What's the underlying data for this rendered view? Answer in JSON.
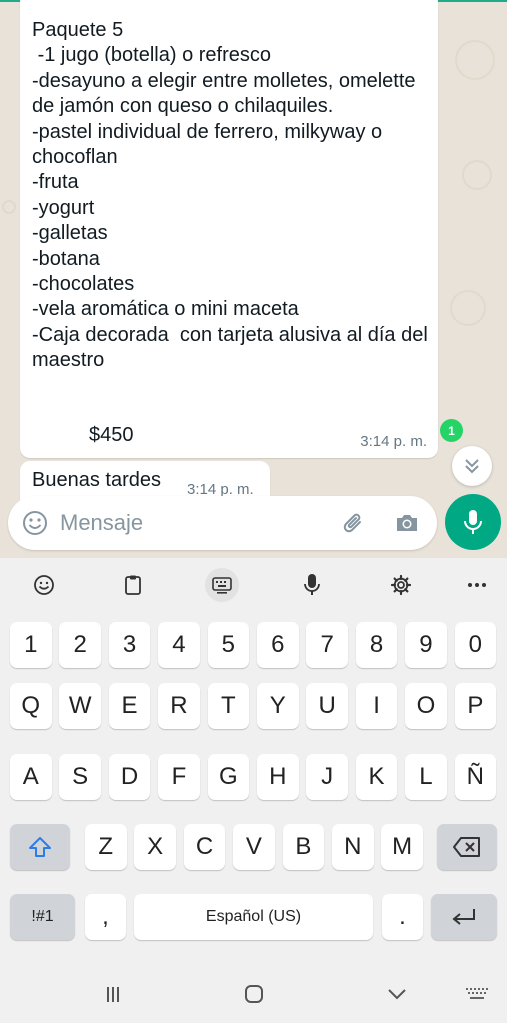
{
  "chat": {
    "messages": [
      {
        "text": "Paquete 5\n -1 jugo (botella) o refresco\n-desayuno a elegir entre molletes, omelette de jamón con queso o chilaquiles.\n-pastel individual de ferrero, milkyway o chocoflan\n-fruta\n-yogurt\n-galletas\n-botana\n-chocolates\n-vela aromática o mini maceta\n-Caja decorada  con tarjeta alusiva al día del maestro",
        "price": "$450",
        "time": "3:14 p. m."
      },
      {
        "text": "Buenas tardes",
        "time": "3:14 p. m."
      }
    ],
    "unread_count": "1"
  },
  "input": {
    "placeholder": "Mensaje"
  },
  "keyboard": {
    "number_row": [
      "1",
      "2",
      "3",
      "4",
      "5",
      "6",
      "7",
      "8",
      "9",
      "0"
    ],
    "row1": [
      "Q",
      "W",
      "E",
      "R",
      "T",
      "Y",
      "U",
      "I",
      "O",
      "P"
    ],
    "row2": [
      "A",
      "S",
      "D",
      "F",
      "G",
      "H",
      "J",
      "K",
      "L",
      "Ñ"
    ],
    "row3": [
      "Z",
      "X",
      "C",
      "V",
      "B",
      "N",
      "M"
    ],
    "symbols_label": "!#1",
    "comma_label": ",",
    "space_label": "Español (US)",
    "period_label": ".",
    "toolbar_icons": [
      "emoji-icon",
      "clipboard-icon",
      "keyboard-icon",
      "mic-icon",
      "gear-icon",
      "more-icon"
    ],
    "accent": "#00a884"
  },
  "navbar": {
    "icons": [
      "recents-icon",
      "home-icon",
      "back-icon",
      "keyboard-switch-icon"
    ]
  }
}
